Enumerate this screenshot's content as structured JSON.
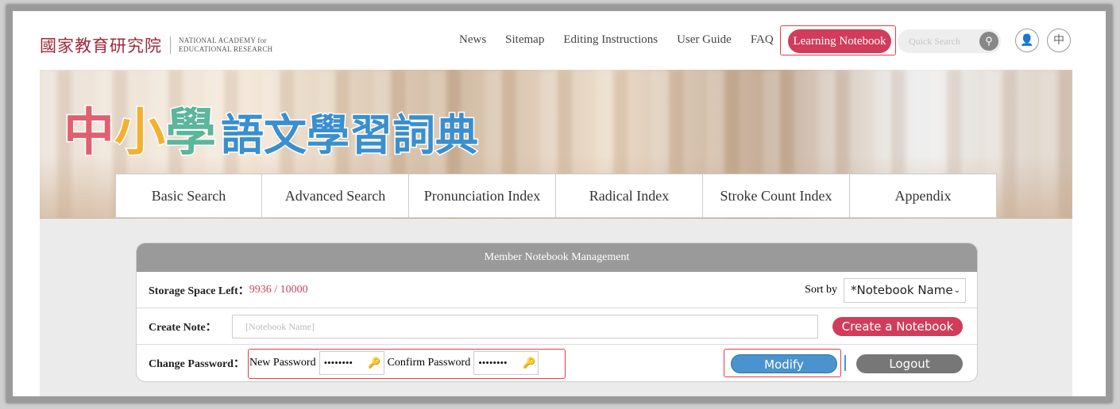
{
  "logo": {
    "zh": "國家教育研究院",
    "en_line1": "NATIONAL ACADEMY for",
    "en_line2": "EDUCATIONAL RESEARCH"
  },
  "nav": {
    "items": [
      "News",
      "Sitemap",
      "Editing Instructions",
      "User Guide",
      "FAQ"
    ],
    "learning_notebook": "Learning Notebook",
    "search_placeholder": "Quick Search",
    "lang": "中"
  },
  "banner": {
    "title_part1": [
      "中",
      "小",
      "學"
    ],
    "title_part2": "語文學習詞典"
  },
  "tabs": [
    "Basic Search",
    "Advanced Search",
    "Pronunciation Index",
    "Radical Index",
    "Stroke Count Index",
    "Appendix"
  ],
  "panel": {
    "title": "Member Notebook Management",
    "storage_label": "Storage Space Left：",
    "storage_value": "9936 / 10000",
    "sort_label": "Sort by",
    "sort_value": "*Notebook Name",
    "create_label": "Create Note：",
    "create_placeholder": "[Notebook Name]",
    "create_button": "Create a Notebook",
    "password_label": "Change Password：",
    "new_password_label": "New Password",
    "new_password_value": "••••••••",
    "confirm_password_label": "Confirm Password",
    "confirm_password_value": "••••••••",
    "modify_button": "Modify",
    "logout_button": "Logout"
  },
  "colors": {
    "accent": "#d13c5a",
    "modify": "#4a93cf",
    "logout": "#777777",
    "highlight": "#e53c45"
  }
}
